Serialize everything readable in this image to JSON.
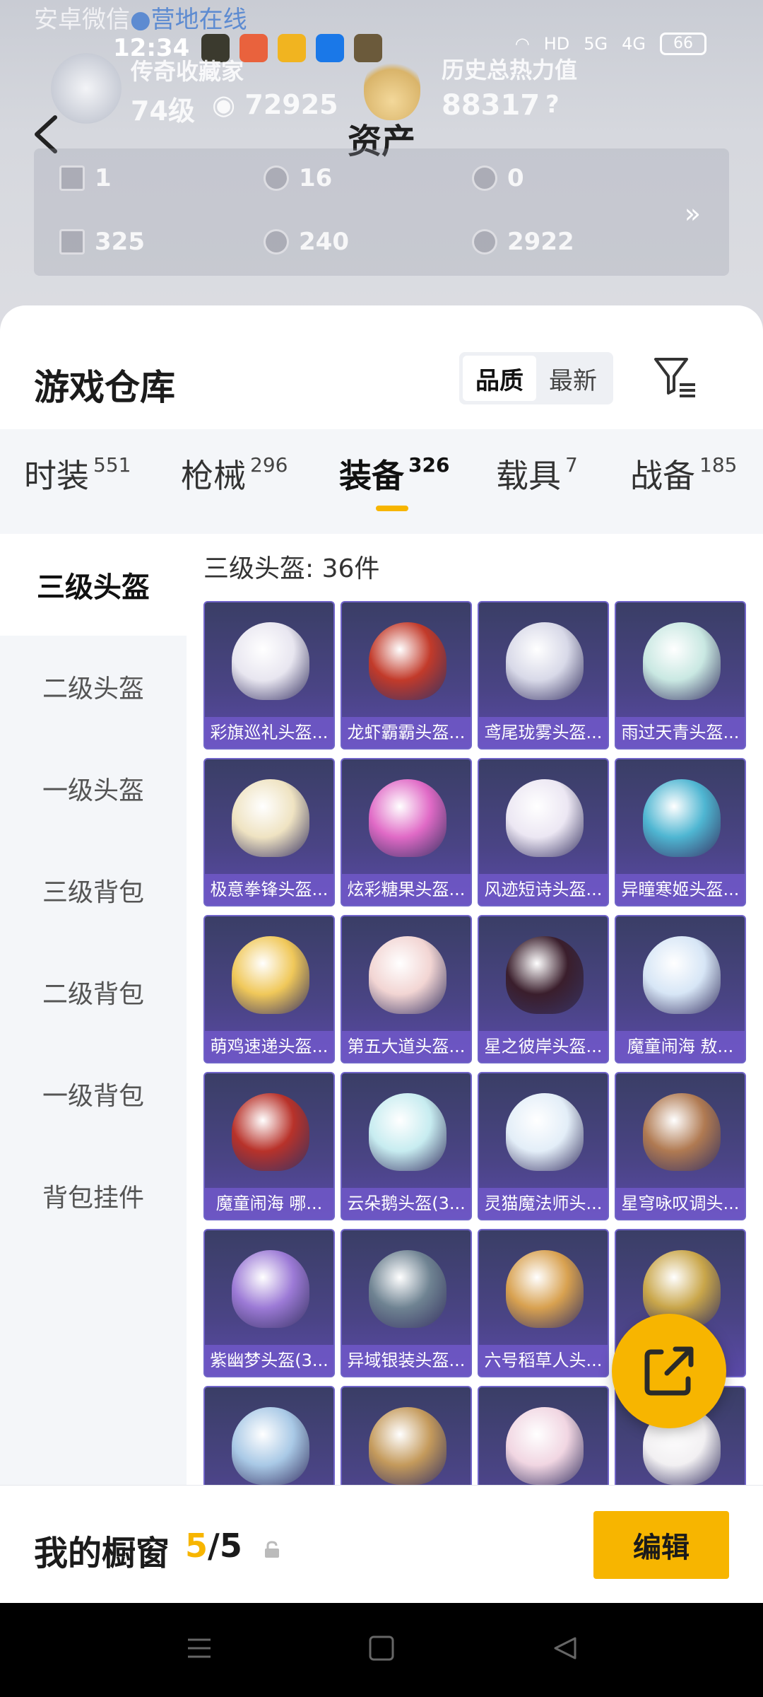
{
  "watermark": {
    "left": "安卓微信",
    "right": "营地在线"
  },
  "status_bar": {
    "time": "12:34",
    "battery": "66",
    "signal_labels": [
      "HD",
      "5G",
      "4G"
    ]
  },
  "profile": {
    "collection_title": "传奇收藏家",
    "level": "74级",
    "points": "72925",
    "power_title": "历史总热力值",
    "power_value": "88317",
    "power_help": "?"
  },
  "page_title": "资产",
  "assets": [
    {
      "icon": "card-icon",
      "value": "1"
    },
    {
      "icon": "coin-icon",
      "value": "16"
    },
    {
      "icon": "medal-icon",
      "value": "0"
    },
    {
      "icon": "ticket-icon",
      "value": "325"
    },
    {
      "icon": "gem-icon",
      "value": "240"
    },
    {
      "icon": "badge-icon",
      "value": "2922"
    }
  ],
  "assets_more": "»",
  "sheet": {
    "title": "游戏仓库",
    "sort_options": [
      "品质",
      "最新"
    ],
    "sort_selected": "品质"
  },
  "tabs": [
    {
      "label": "时装",
      "count": "551"
    },
    {
      "label": "枪械",
      "count": "296"
    },
    {
      "label": "装备",
      "count": "326",
      "active": true
    },
    {
      "label": "载具",
      "count": "7"
    },
    {
      "label": "战备",
      "count": "185"
    }
  ],
  "side_categories": [
    "三级头盔",
    "二级头盔",
    "一级头盔",
    "三级背包",
    "二级背包",
    "一级背包",
    "背包挂件"
  ],
  "selected_category": "三级头盔",
  "item_count_label": "三级头盔: 36件",
  "items": [
    {
      "name": "彩旗巡礼头盔...",
      "color": "#e8e6f0"
    },
    {
      "name": "龙虾霸霸头盔...",
      "color": "#c23a2a"
    },
    {
      "name": "鸢尾珑雾头盔...",
      "color": "#d8d9e8"
    },
    {
      "name": "雨过天青头盔...",
      "color": "#c9e8e2"
    },
    {
      "name": "极意拳锋头盔...",
      "color": "#efe3c2"
    },
    {
      "name": "炫彩糖果头盔...",
      "color": "#e06ac6"
    },
    {
      "name": "风迹短诗头盔...",
      "color": "#ece7f3"
    },
    {
      "name": "异瞳寒姬头盔...",
      "color": "#4fb6d2"
    },
    {
      "name": "萌鸡速递头盔...",
      "color": "#f0c85a"
    },
    {
      "name": "第五大道头盔...",
      "color": "#f2d5d3"
    },
    {
      "name": "星之彼岸头盔...",
      "color": "#3a1e2c"
    },
    {
      "name": "魔童闹海 敖...",
      "color": "#d7e6f6"
    },
    {
      "name": "魔童闹海 哪...",
      "color": "#b8322a"
    },
    {
      "name": "云朵鹅头盔(3...",
      "color": "#c7ecf0"
    },
    {
      "name": "灵猫魔法师头...",
      "color": "#e3eef8"
    },
    {
      "name": "星穹咏叹调头...",
      "color": "#b07a52"
    },
    {
      "name": "紫幽梦头盔(3...",
      "color": "#9c7ad6"
    },
    {
      "name": "异域银装头盔...",
      "color": "#6f8392"
    },
    {
      "name": "六号稻草人头...",
      "color": "#d8a150"
    },
    {
      "name": "",
      "color": "#c9a64a"
    },
    {
      "name": "",
      "color": "#a9c9e6"
    },
    {
      "name": "",
      "color": "#c49a5c"
    },
    {
      "name": "",
      "color": "#f1d6e2"
    },
    {
      "name": "",
      "color": "#f2f0f2"
    }
  ],
  "fab": {
    "icon": "share-icon"
  },
  "showcase": {
    "title": "我的橱窗",
    "filled": "5",
    "total": "/5",
    "button": "编辑"
  },
  "nav_icons": [
    "menu-icon",
    "home-icon",
    "back-icon"
  ]
}
